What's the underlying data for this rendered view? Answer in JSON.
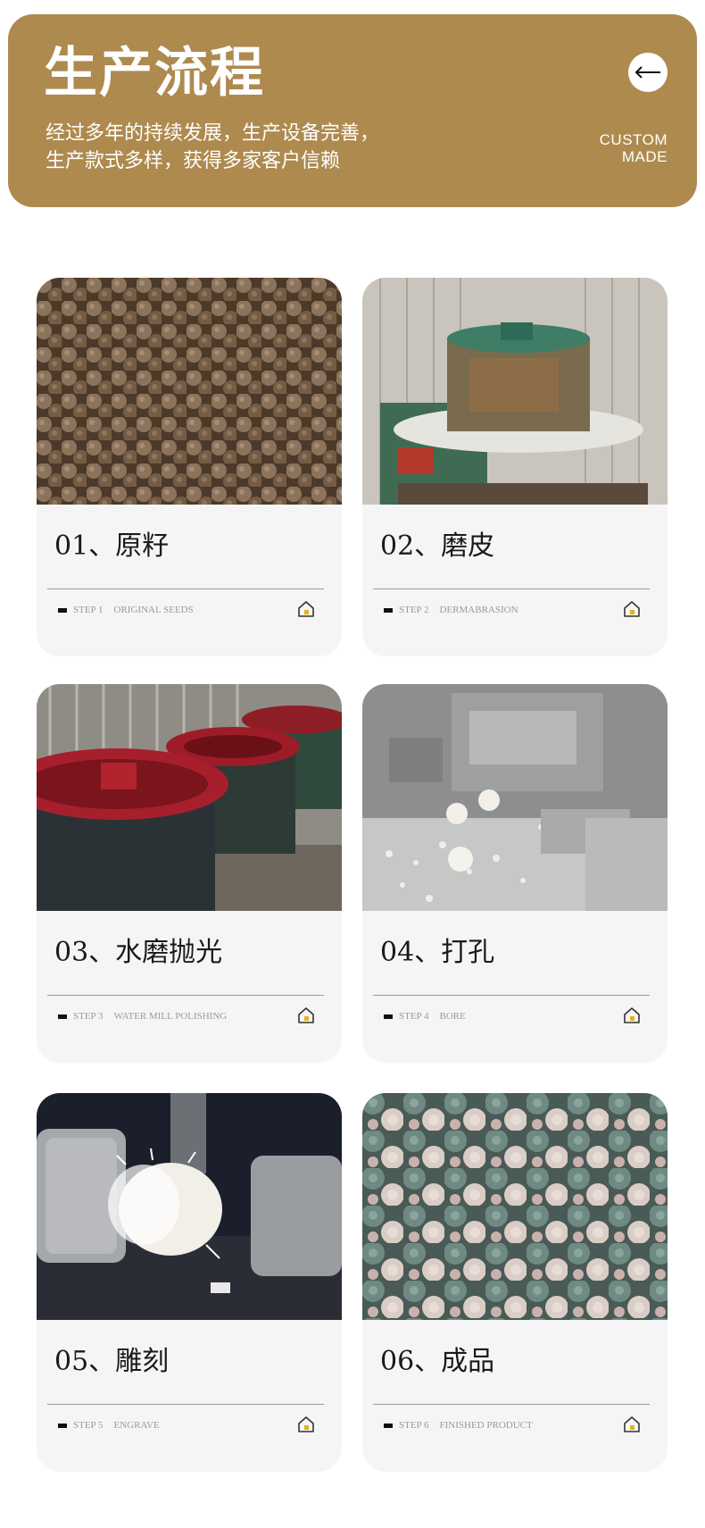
{
  "header": {
    "title": "生产流程",
    "subtitle_line1": "经过多年的持续发展，生产设备完善，",
    "subtitle_line2": "生产款式多样，获得多家客户信赖",
    "back_icon": "arrow-left-icon",
    "badge_line1": "CUSTOM",
    "badge_line2": "MADE"
  },
  "steps": [
    {
      "title": "01、原籽",
      "step_label": "STEP 1",
      "step_name": "ORIGINAL SEEDS",
      "image": "seeds-photo"
    },
    {
      "title": "02、磨皮",
      "step_label": "STEP 2",
      "step_name": "DERMABRASION",
      "image": "grinding-machine-photo"
    },
    {
      "title": "03、水磨抛光",
      "step_label": "STEP 3",
      "step_name": "WATER MILL POLISHING",
      "image": "polishing-tubs-photo"
    },
    {
      "title": "04、打孔",
      "step_label": "STEP 4",
      "step_name": "BORE",
      "image": "drilling-machine-photo"
    },
    {
      "title": "05、雕刻",
      "step_label": "STEP 5",
      "step_name": "ENGRAVE",
      "image": "engraving-photo"
    },
    {
      "title": "06、成品",
      "step_label": "STEP 6",
      "step_name": "FINISHED PRODUCT",
      "image": "finished-beads-photo"
    }
  ],
  "colors": {
    "banner": "#AE8A4F",
    "card": "#F5F5F5",
    "accent": "#E8B020"
  }
}
